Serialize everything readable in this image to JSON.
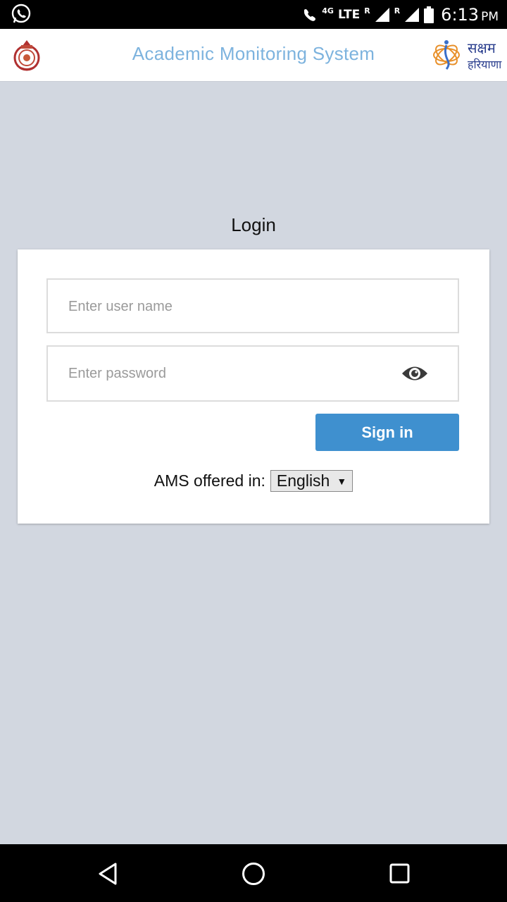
{
  "status_bar": {
    "network_small": "4G",
    "network_type": "LTE",
    "roaming_1": "R",
    "roaming_2": "R",
    "time": "6:13",
    "ampm": "PM"
  },
  "header": {
    "title": "Academic Monitoring System",
    "logo_text_line1": "सक्षम",
    "logo_text_line2": "हरियाणा"
  },
  "login": {
    "heading": "Login",
    "username_placeholder": "Enter user name",
    "username_value": "",
    "password_placeholder": "Enter password",
    "password_value": "",
    "signin_label": "Sign in",
    "language_label": "AMS offered in:",
    "language_selected": "English"
  },
  "icons": {
    "status": [
      "whatsapp-icon",
      "wifi-call-icon",
      "signal-icon",
      "battery-icon"
    ],
    "login": [
      "eye-icon",
      "dropdown-arrow-icon"
    ],
    "nav": [
      "back-icon",
      "home-icon",
      "recents-icon"
    ]
  },
  "colors": {
    "background": "#d2d7e0",
    "title": "#7db3de",
    "signin_button": "#3f90cf",
    "logo_text": "#2a3e8e"
  }
}
